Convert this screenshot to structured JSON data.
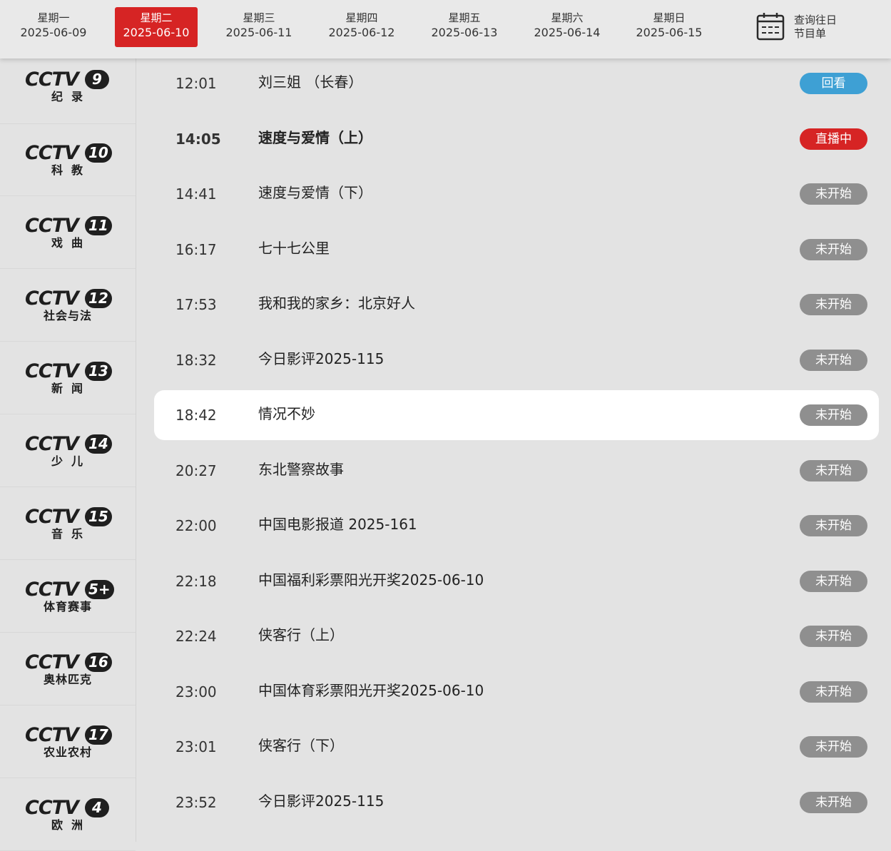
{
  "datebar": {
    "days": [
      {
        "weekday": "星期一",
        "date": "2025-06-09",
        "active": false
      },
      {
        "weekday": "星期二",
        "date": "2025-06-10",
        "active": true
      },
      {
        "weekday": "星期三",
        "date": "2025-06-11",
        "active": false
      },
      {
        "weekday": "星期四",
        "date": "2025-06-12",
        "active": false
      },
      {
        "weekday": "星期五",
        "date": "2025-06-13",
        "active": false
      },
      {
        "weekday": "星期六",
        "date": "2025-06-14",
        "active": false
      },
      {
        "weekday": "星期日",
        "date": "2025-06-15",
        "active": false
      }
    ],
    "history": {
      "line1": "查询往日",
      "line2": "节目单",
      "icon": "calendar-icon"
    },
    "active_color": "#d62424"
  },
  "channels": [
    {
      "brand": "CCTV",
      "number": "9",
      "name": "纪录"
    },
    {
      "brand": "CCTV",
      "number": "10",
      "name": "科教"
    },
    {
      "brand": "CCTV",
      "number": "11",
      "name": "戏曲"
    },
    {
      "brand": "CCTV",
      "number": "12",
      "name": "社会与法"
    },
    {
      "brand": "CCTV",
      "number": "13",
      "name": "新闻"
    },
    {
      "brand": "CCTV",
      "number": "14",
      "name": "少儿"
    },
    {
      "brand": "CCTV",
      "number": "15",
      "name": "音乐"
    },
    {
      "brand": "CCTV",
      "number": "5+",
      "name": "体育赛事"
    },
    {
      "brand": "CCTV",
      "number": "16",
      "name": "奥林匹克"
    },
    {
      "brand": "CCTV",
      "number": "17",
      "name": "农业农村"
    },
    {
      "brand": "CCTV",
      "number": "4",
      "name": "欧洲"
    }
  ],
  "programs": [
    {
      "time": "12:01",
      "title": "刘三姐 （长春）",
      "status": "回看",
      "kind": "replay"
    },
    {
      "time": "14:05",
      "title": "速度与爱情（上）",
      "status": "直播中",
      "kind": "live"
    },
    {
      "time": "14:41",
      "title": "速度与爱情（下）",
      "status": "未开始",
      "kind": "upcoming"
    },
    {
      "time": "16:17",
      "title": "七十七公里",
      "status": "未开始",
      "kind": "upcoming"
    },
    {
      "time": "17:53",
      "title": "我和我的家乡：北京好人",
      "status": "未开始",
      "kind": "upcoming"
    },
    {
      "time": "18:32",
      "title": "今日影评2025-115",
      "status": "未开始",
      "kind": "upcoming"
    },
    {
      "time": "18:42",
      "title": "情况不妙",
      "status": "未开始",
      "kind": "upcoming",
      "highlighted": true
    },
    {
      "time": "20:27",
      "title": "东北警察故事",
      "status": "未开始",
      "kind": "upcoming"
    },
    {
      "time": "22:00",
      "title": "中国电影报道 2025-161",
      "status": "未开始",
      "kind": "upcoming"
    },
    {
      "time": "22:18",
      "title": "中国福利彩票阳光开奖2025-06-10",
      "status": "未开始",
      "kind": "upcoming"
    },
    {
      "time": "22:24",
      "title": "侠客行（上）",
      "status": "未开始",
      "kind": "upcoming"
    },
    {
      "time": "23:00",
      "title": "中国体育彩票阳光开奖2025-06-10",
      "status": "未开始",
      "kind": "upcoming"
    },
    {
      "time": "23:01",
      "title": "侠客行（下）",
      "status": "未开始",
      "kind": "upcoming"
    },
    {
      "time": "23:52",
      "title": "今日影评2025-115",
      "status": "未开始",
      "kind": "upcoming"
    }
  ],
  "status_colors": {
    "replay": "#3ea0d4",
    "live": "#d62424",
    "upcoming": "#8f8f8f"
  }
}
